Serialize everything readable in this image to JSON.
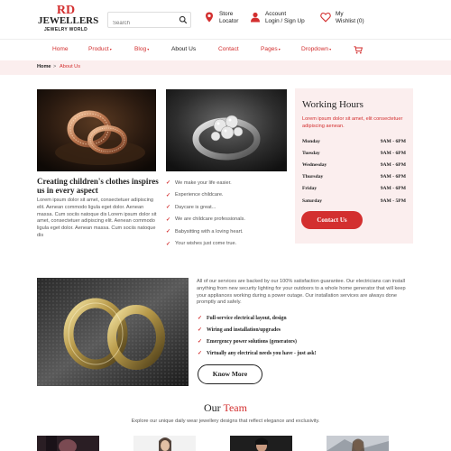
{
  "logo": {
    "line1": "RD",
    "line2": "JEWELLERS",
    "line3": "JEWELRY WORLD"
  },
  "search": {
    "placeholder": "Search",
    "value": ""
  },
  "header": {
    "store": {
      "line1": "Store",
      "line2": "Locator",
      "icon": "location-pin-icon"
    },
    "account": {
      "line1": "Account",
      "line2": "Login / Sign Up",
      "icon": "user-icon"
    },
    "wishlist": {
      "line1": "My",
      "line2": "Wishlist (0)",
      "icon": "heart-icon"
    }
  },
  "nav": {
    "items": [
      {
        "label": "Home",
        "dropdown": false
      },
      {
        "label": "Product",
        "dropdown": true
      },
      {
        "label": "Blog",
        "dropdown": true
      },
      {
        "label": "About Us",
        "dropdown": false,
        "active": true
      },
      {
        "label": "Contact",
        "dropdown": false
      },
      {
        "label": "Pages",
        "dropdown": true
      },
      {
        "label": "Dropdown",
        "dropdown": true
      }
    ],
    "dropdown_caret": "▾",
    "cart_icon": "cart-icon"
  },
  "breadcrumb": {
    "home": "Home",
    "separator": ">",
    "current": "About Us"
  },
  "section1": {
    "title": "Creating children's clothes inspires us in every aspect",
    "text": "Lorem ipsum dolor sit amet, consectetuer adipiscing elit. Aenean commodo ligula eget dolor. Aenean massa. Cum sociis natoque dis Lorem ipsum dolor sit amet, consectetuer adipiscing elit. Aenean commodo ligula eget dolor. Aenean massa. Cum sociis natoque dis",
    "checklist": [
      "We make your life easier.",
      "Experience childcare.",
      "Daycare is great...",
      "We are childcare professionals.",
      "Babysitting with a loving heart.",
      "Your wishes just come true."
    ]
  },
  "hours": {
    "title": "Working Hours",
    "desc": "Lorem ipsum dolor sit amet, elit consectetuer adipiscing aenean.",
    "rows": [
      {
        "day": "Monday",
        "time": "9AM - 6PM"
      },
      {
        "day": "Tuesday",
        "time": "9AM - 6PM"
      },
      {
        "day": "Wednesday",
        "time": "9AM - 6PM"
      },
      {
        "day": "Thursday",
        "time": "9AM - 6PM"
      },
      {
        "day": "Friday",
        "time": "9AM - 6PM"
      },
      {
        "day": "Saturday",
        "time": "9AM - 5PM"
      }
    ],
    "button": "Contact Us"
  },
  "section2": {
    "text": "All of our services are backed by our 100% satisfaction guarantee. Our electricians can install anything from new security lighting for your outdoors to a whole home generator that will keep your appliances working during a power outage. Our installation services are always done promptly and safely.",
    "checklist": [
      "Full-service electrical layout, design",
      "Wiring and installation/upgrades",
      "Emergency power solutions (generators)",
      "Virtually any electrical needs you have - just ask!"
    ],
    "button": "Know More"
  },
  "team": {
    "title_a": "Our",
    "title_b": "Team",
    "subtitle": "Explore our unique daily wear jewellery designs that reflect elegance and exclusivity."
  },
  "colors": {
    "accent": "#d32f2f",
    "soft_bg": "#fbeeee",
    "text": "#222222"
  }
}
